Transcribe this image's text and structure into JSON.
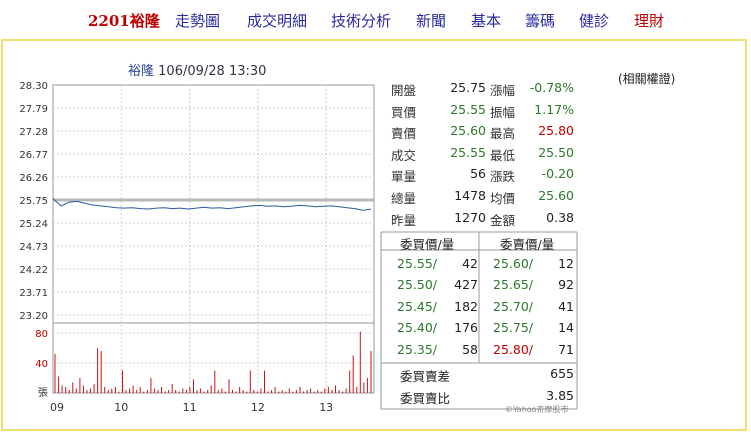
{
  "nav": [
    {
      "label": "2201裕隆",
      "style": "active"
    },
    {
      "label": "走勢圖",
      "style": "normal"
    },
    {
      "label": "成交明細",
      "style": "normal"
    },
    {
      "label": "技術分析",
      "style": "normal"
    },
    {
      "label": "新聞",
      "style": "normal"
    },
    {
      "label": "基本",
      "style": "normal"
    },
    {
      "label": "籌碼",
      "style": "normal"
    },
    {
      "label": "健診",
      "style": "normal"
    },
    {
      "label": "理財",
      "style": "red"
    }
  ],
  "chart": {
    "stock_name": "裕隆",
    "datetime": "106/09/28 13:30"
  },
  "related_warrants": "(相關權證)",
  "quote": [
    {
      "label": "開盤",
      "value": "25.75",
      "color": "black",
      "label2": "漲幅",
      "value2": "-0.78%",
      "color2": "green"
    },
    {
      "label": "買價",
      "value": "25.55",
      "color": "green",
      "label2": "振幅",
      "value2": "1.17%",
      "color2": "green"
    },
    {
      "label": "賣價",
      "value": "25.60",
      "color": "green",
      "label2": "最高",
      "value2": "25.80",
      "color2": "red"
    },
    {
      "label": "成交",
      "value": "25.55",
      "color": "green",
      "label2": "最低",
      "value2": "25.50",
      "color2": "green"
    },
    {
      "label": "單量",
      "value": "56",
      "color": "black",
      "label2": "漲跌",
      "value2": "-0.20",
      "color2": "green"
    },
    {
      "label": "總量",
      "value": "1478",
      "color": "black",
      "label2": "均價",
      "value2": "25.60",
      "color2": "green"
    },
    {
      "label": "昨量",
      "value": "1270",
      "color": "black",
      "label2": "金額",
      "value2": "0.38",
      "color2": "black"
    }
  ],
  "book": {
    "buy_header": "委買價/量",
    "sell_header": "委賣價/量",
    "rows": [
      {
        "bid": "25.55/",
        "bid_qty": "42",
        "bid_color": "green",
        "ask": "25.60/",
        "ask_qty": "12",
        "ask_color": "green"
      },
      {
        "bid": "25.50/",
        "bid_qty": "427",
        "bid_color": "green",
        "ask": "25.65/",
        "ask_qty": "92",
        "ask_color": "green"
      },
      {
        "bid": "25.45/",
        "bid_qty": "182",
        "bid_color": "green",
        "ask": "25.70/",
        "ask_qty": "41",
        "ask_color": "green"
      },
      {
        "bid": "25.40/",
        "bid_qty": "176",
        "bid_color": "green",
        "ask": "25.75/",
        "ask_qty": "14",
        "ask_color": "green"
      },
      {
        "bid": "25.35/",
        "bid_qty": "58",
        "bid_color": "green",
        "ask": "25.80/",
        "ask_qty": "71",
        "ask_color": "red"
      }
    ],
    "diff_label": "委買賣差",
    "diff_value": "655",
    "ratio_label": "委買賣比",
    "ratio_value": "3.85"
  },
  "watermark": "©Yahoo奇摩股市",
  "chart_data": {
    "type": "line",
    "price_ticks": [
      "28.30",
      "27.79",
      "27.28",
      "26.77",
      "26.26",
      "25.75",
      "25.24",
      "24.73",
      "24.22",
      "23.71",
      "23.20"
    ],
    "price_ylim": [
      23.2,
      28.3
    ],
    "reference_price": 25.75,
    "volume_ticks": [
      "80",
      "40",
      "張"
    ],
    "volume_ylim": [
      0,
      80
    ],
    "time_ticks": [
      "09",
      "10",
      "11",
      "12",
      "13"
    ],
    "price_series": [
      25.78,
      25.62,
      25.7,
      25.72,
      25.68,
      25.64,
      25.62,
      25.6,
      25.58,
      25.57,
      25.58,
      25.56,
      25.55,
      25.57,
      25.58,
      25.56,
      25.57,
      25.55,
      25.57,
      25.59,
      25.57,
      25.58,
      25.56,
      25.58,
      25.6,
      25.62,
      25.63,
      25.61,
      25.62,
      25.6,
      25.61,
      25.63,
      25.62,
      25.6,
      25.61,
      25.62,
      25.6,
      25.58,
      25.56,
      25.52,
      25.55
    ],
    "volume_series": [
      52,
      22,
      10,
      8,
      4,
      14,
      6,
      20,
      10,
      4,
      6,
      12,
      60,
      56,
      8,
      4,
      6,
      8,
      2,
      30,
      4,
      6,
      10,
      4,
      8,
      2,
      4,
      20,
      6,
      4,
      8,
      2,
      4,
      12,
      4,
      2,
      6,
      4,
      8,
      18,
      4,
      6,
      2,
      4,
      10,
      30,
      4,
      6,
      2,
      18,
      4,
      2,
      8,
      4,
      2,
      30,
      4,
      2,
      6,
      30,
      2,
      4,
      8,
      2,
      4,
      2,
      6,
      2,
      4,
      8,
      2,
      4,
      6,
      2,
      4,
      2,
      6,
      8,
      4,
      10,
      4,
      2,
      6,
      30,
      50,
      8,
      82,
      14,
      20,
      56
    ]
  }
}
